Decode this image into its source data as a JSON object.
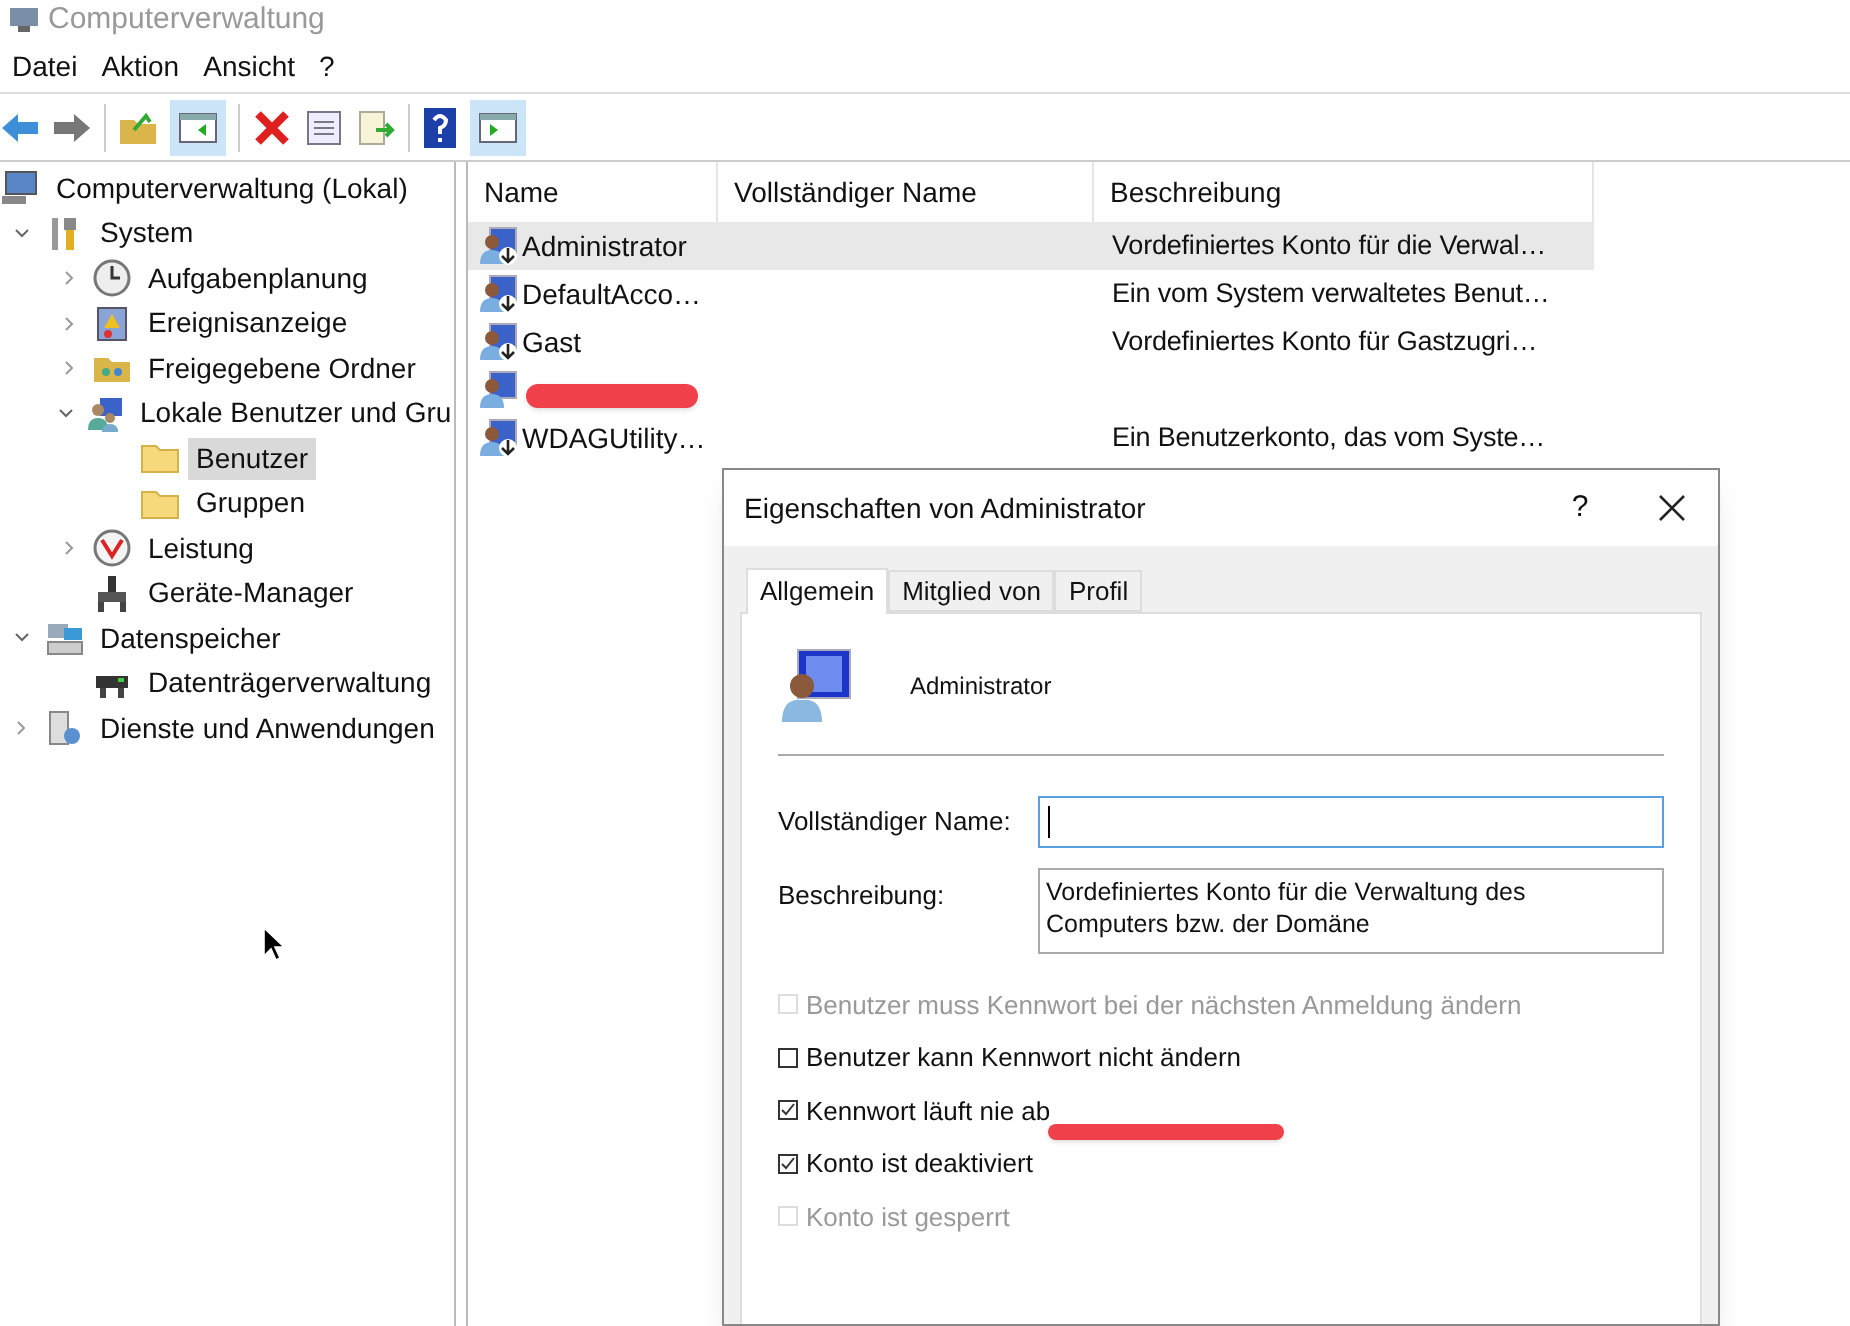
{
  "window": {
    "title": "Computerverwaltung"
  },
  "menu": [
    "Datei",
    "Aktion",
    "Ansicht",
    "?"
  ],
  "tree": [
    {
      "label": "Computerverwaltung (Lokal)",
      "selected": false,
      "children": [
        {
          "label": "System",
          "expanded": true,
          "selected": false,
          "children": [
            {
              "label": "Aufgabenplanung",
              "expanded": false,
              "selected": false
            },
            {
              "label": "Ereignisanzeige",
              "expanded": false,
              "selected": false
            },
            {
              "label": "Freigegebene Ordner",
              "expanded": false,
              "selected": false
            },
            {
              "label": "Lokale Benutzer und Gru",
              "expanded": true,
              "selected": false,
              "children": [
                {
                  "label": "Benutzer",
                  "selected": true
                },
                {
                  "label": "Gruppen",
                  "selected": false
                }
              ]
            },
            {
              "label": "Leistung",
              "expanded": false,
              "selected": false
            },
            {
              "label": "Geräte-Manager",
              "selected": false
            }
          ]
        },
        {
          "label": "Datenspeicher",
          "expanded": true,
          "selected": false,
          "children": [
            {
              "label": "Datenträgerverwaltung",
              "selected": false
            }
          ]
        },
        {
          "label": "Dienste und Anwendungen",
          "expanded": false,
          "selected": false
        }
      ]
    }
  ],
  "table": {
    "columns": [
      "Name",
      "Vollständiger Name",
      "Beschreibung"
    ],
    "rows": [
      {
        "name": "Administrator",
        "description": "Vordefiniertes Konto für die Verwal…",
        "selected": true,
        "disabled": true,
        "redacted": false
      },
      {
        "name": "DefaultAcco…",
        "description": "Ein vom System verwaltetes Benut…",
        "selected": false,
        "disabled": true,
        "redacted": false
      },
      {
        "name": "Gast",
        "description": "Vordefiniertes Konto für Gastzugri…",
        "selected": false,
        "disabled": true,
        "redacted": false
      },
      {
        "selected": false,
        "disabled": false,
        "redacted": true
      },
      {
        "name": "WDAGUtility…",
        "description": "Ein Benutzerkonto, das vom Syste…",
        "selected": false,
        "disabled": true,
        "redacted": false
      }
    ]
  },
  "dialog": {
    "title": "Eigenschaften von Administrator",
    "help": "?",
    "tabs": [
      {
        "label": "Allgemein",
        "selected": true
      },
      {
        "label": "Mitglied von",
        "selected": false
      },
      {
        "label": "Profil",
        "selected": false
      }
    ],
    "user_name": "Administrator",
    "full_name_label": "Vollständiger Name:",
    "description_label": "Beschreibung:",
    "description": "Vordefiniertes Konto für die Verwaltung des Computers bzw. der Domäne",
    "options": [
      {
        "label": "Benutzer muss Kennwort bei der nächsten Anmeldung ändern",
        "checked": false,
        "disabled": true,
        "marked": false
      },
      {
        "label": "Benutzer kann Kennwort nicht ändern",
        "checked": false,
        "disabled": false,
        "marked": false
      },
      {
        "label": "Kennwort läuft nie ab",
        "checked": true,
        "disabled": false,
        "marked": true
      },
      {
        "label": "Konto ist deaktiviert",
        "checked": true,
        "disabled": false,
        "marked": false
      },
      {
        "label": "Konto ist gesperrt",
        "checked": false,
        "disabled": true,
        "marked": false
      }
    ]
  }
}
